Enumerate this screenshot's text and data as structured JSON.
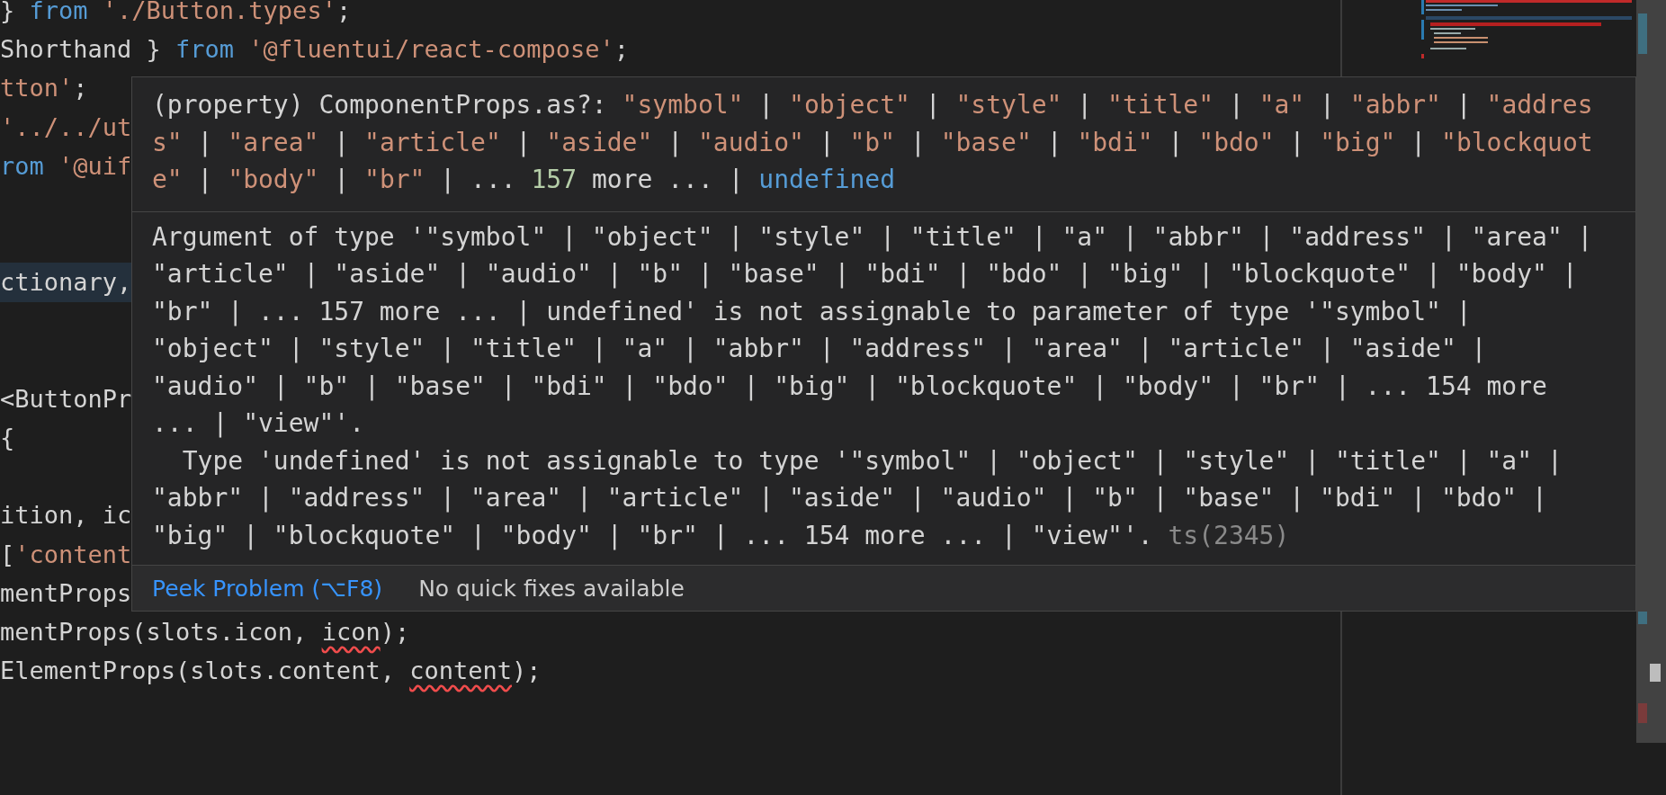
{
  "editor": {
    "lines": [
      {
        "kind": "code",
        "highlighted": false,
        "tokens": [
          {
            "text": "} ",
            "kind": "plain"
          },
          {
            "text": "from",
            "kind": "keyword"
          },
          {
            "text": " './Button.types'",
            "kind": "string"
          },
          {
            "text": ";",
            "kind": "plain"
          }
        ]
      },
      {
        "kind": "code",
        "highlighted": false,
        "tokens": [
          {
            "text": "Shorthand } ",
            "kind": "plain"
          },
          {
            "text": "from",
            "kind": "keyword"
          },
          {
            "text": " '@fluentui/react-compose'",
            "kind": "string"
          },
          {
            "text": ";",
            "kind": "plain"
          }
        ]
      },
      {
        "kind": "code",
        "highlighted": false,
        "tokens": [
          {
            "text": "tton'",
            "kind": "string"
          },
          {
            "text": ";",
            "kind": "plain"
          }
        ]
      },
      {
        "kind": "code",
        "highlighted": false,
        "tokens": [
          {
            "text": "'../../ut",
            "kind": "string"
          }
        ]
      },
      {
        "kind": "code",
        "highlighted": false,
        "tokens": [
          {
            "text": "rom",
            "kind": "keyword"
          },
          {
            "text": " '@uif",
            "kind": "string"
          }
        ]
      },
      {
        "kind": "blank"
      },
      {
        "kind": "blank"
      },
      {
        "kind": "code",
        "highlighted": true,
        "tokens": [
          {
            "text": "ctionary,",
            "kind": "plain"
          }
        ]
      },
      {
        "kind": "blank"
      },
      {
        "kind": "blank"
      },
      {
        "kind": "code",
        "highlighted": false,
        "tokens": [
          {
            "text": "<ButtonPr",
            "kind": "plain"
          }
        ]
      },
      {
        "kind": "code",
        "highlighted": false,
        "tokens": [
          {
            "text": "{",
            "kind": "plain"
          }
        ]
      },
      {
        "kind": "blank"
      },
      {
        "kind": "code",
        "highlighted": false,
        "tokens": [
          {
            "text": "ition, ic",
            "kind": "plain"
          }
        ]
      },
      {
        "kind": "code",
        "highlighted": false,
        "tokens": [
          {
            "text": "[",
            "kind": "plain"
          },
          {
            "text": "'content",
            "kind": "string"
          }
        ]
      },
      {
        "kind": "code",
        "highlighted": false,
        "tokens": [
          {
            "text": "mentProps",
            "kind": "plain"
          }
        ]
      },
      {
        "kind": "code",
        "highlighted": false,
        "tokens": [
          {
            "text": "mentProps(slots.icon, ",
            "kind": "plain"
          },
          {
            "text": "icon",
            "kind": "error"
          },
          {
            "text": ");",
            "kind": "plain"
          }
        ]
      },
      {
        "kind": "code",
        "highlighted": false,
        "tokens": [
          {
            "text": "ElementProps(slots.content, ",
            "kind": "plain"
          },
          {
            "text": "content",
            "kind": "error"
          },
          {
            "text": ");",
            "kind": "plain"
          }
        ]
      }
    ]
  },
  "hover": {
    "signature": [
      [
        {
          "text": "(property) ComponentProps.as?: ",
          "kind": "plain"
        },
        {
          "text": "\"symbol\"",
          "kind": "string"
        },
        {
          "text": " | ",
          "kind": "plain"
        },
        {
          "text": "\"object\"",
          "kind": "string"
        },
        {
          "text": " | ",
          "kind": "plain"
        },
        {
          "text": "\"style\"",
          "kind": "string"
        },
        {
          "text": " | ",
          "kind": "plain"
        },
        {
          "text": "\"title\"",
          "kind": "string"
        },
        {
          "text": " | ",
          "kind": "plain"
        },
        {
          "text": "\"a\"",
          "kind": "string"
        },
        {
          "text": " | ",
          "kind": "plain"
        },
        {
          "text": "\"abbr\"",
          "kind": "string"
        },
        {
          "text": " | ",
          "kind": "plain"
        },
        {
          "text": "\"addres",
          "kind": "string"
        }
      ],
      [
        {
          "text": "s\"",
          "kind": "string"
        },
        {
          "text": " | ",
          "kind": "plain"
        },
        {
          "text": "\"area\"",
          "kind": "string"
        },
        {
          "text": " | ",
          "kind": "plain"
        },
        {
          "text": "\"article\"",
          "kind": "string"
        },
        {
          "text": " | ",
          "kind": "plain"
        },
        {
          "text": "\"aside\"",
          "kind": "string"
        },
        {
          "text": " | ",
          "kind": "plain"
        },
        {
          "text": "\"audio\"",
          "kind": "string"
        },
        {
          "text": " | ",
          "kind": "plain"
        },
        {
          "text": "\"b\"",
          "kind": "string"
        },
        {
          "text": " | ",
          "kind": "plain"
        },
        {
          "text": "\"base\"",
          "kind": "string"
        },
        {
          "text": " | ",
          "kind": "plain"
        },
        {
          "text": "\"bdi\"",
          "kind": "string"
        },
        {
          "text": " | ",
          "kind": "plain"
        },
        {
          "text": "\"bdo\"",
          "kind": "string"
        },
        {
          "text": " | ",
          "kind": "plain"
        },
        {
          "text": "\"big\"",
          "kind": "string"
        },
        {
          "text": " | ",
          "kind": "plain"
        },
        {
          "text": "\"blockquot",
          "kind": "string"
        }
      ],
      [
        {
          "text": "e\"",
          "kind": "string"
        },
        {
          "text": " | ",
          "kind": "plain"
        },
        {
          "text": "\"body\"",
          "kind": "string"
        },
        {
          "text": " | ",
          "kind": "plain"
        },
        {
          "text": "\"br\"",
          "kind": "string"
        },
        {
          "text": " | ... ",
          "kind": "plain"
        },
        {
          "text": "157",
          "kind": "number"
        },
        {
          "text": " more ... | ",
          "kind": "plain"
        },
        {
          "text": "undefined",
          "kind": "keyword"
        }
      ]
    ],
    "message": [
      [
        {
          "text": "Argument of type '\"symbol\" | \"object\" | \"style\" | \"title\" | \"a\" | \"abbr\" | \"address\" | \"area\" |",
          "kind": "plain"
        }
      ],
      [
        {
          "text": "\"article\" | \"aside\" | \"audio\" | \"b\" | \"base\" | \"bdi\" | \"bdo\" | \"big\" | \"blockquote\" | \"body\" |",
          "kind": "plain"
        }
      ],
      [
        {
          "text": "\"br\" | ... 157 more ... | undefined' is not assignable to parameter of type '\"symbol\" |",
          "kind": "plain"
        }
      ],
      [
        {
          "text": "\"object\" | \"style\" | \"title\" | \"a\" | \"abbr\" | \"address\" | \"area\" | \"article\" | \"aside\" |",
          "kind": "plain"
        }
      ],
      [
        {
          "text": "\"audio\" | \"b\" | \"base\" | \"bdi\" | \"bdo\" | \"big\" | \"blockquote\" | \"body\" | \"br\" | ... 154 more",
          "kind": "plain"
        }
      ],
      [
        {
          "text": "... | \"view\"'.",
          "kind": "plain"
        }
      ],
      [
        {
          "text": "  Type 'undefined' is not assignable to type '\"symbol\" | \"object\" | \"style\" | \"title\" | \"a\" |",
          "kind": "plain"
        }
      ],
      [
        {
          "text": "\"abbr\" | \"address\" | \"area\" | \"article\" | \"aside\" | \"audio\" | \"b\" | \"base\" | \"bdi\" | \"bdo\" |",
          "kind": "plain"
        }
      ],
      [
        {
          "text": "\"big\" | \"blockquote\" | \"body\" | \"br\" | ... 154 more ... | \"view\"'. ",
          "kind": "plain"
        },
        {
          "text": "ts(2345)",
          "kind": "code"
        }
      ]
    ],
    "peek_link": "Peek Problem (⌥F8)",
    "quick_fix_note": "No quick fixes available"
  }
}
